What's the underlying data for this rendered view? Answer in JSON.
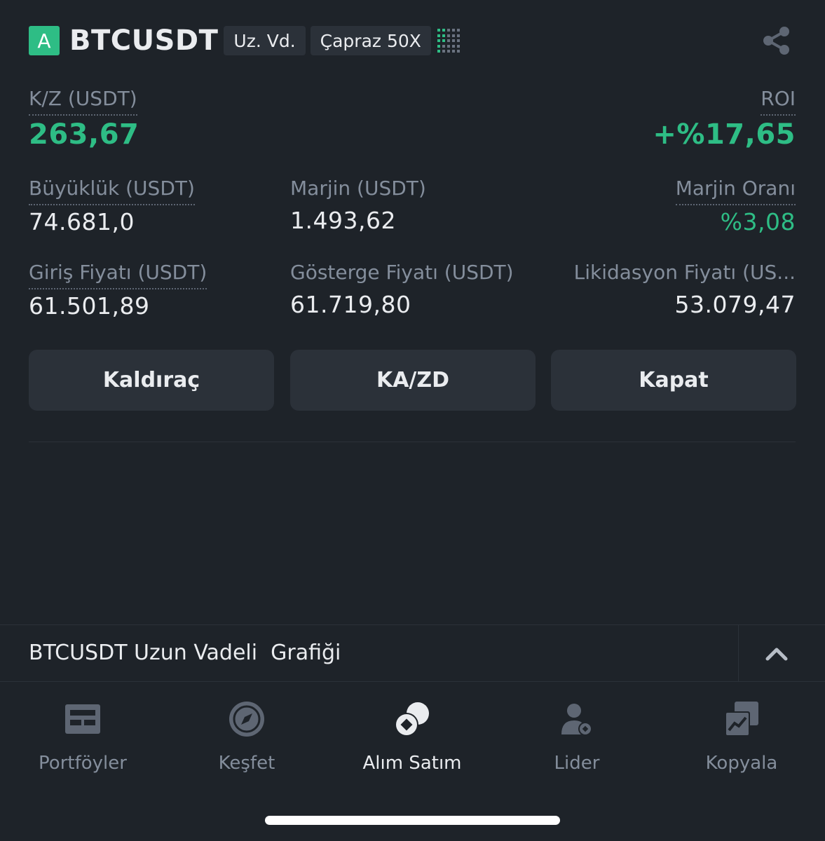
{
  "header": {
    "badge": "A",
    "symbol": "BTCUSDT",
    "tag_term": "Uz. Vd.",
    "tag_margin": "Çapraz 50X",
    "icon_share": "share-icon"
  },
  "position": {
    "pnl_label": "K/Z (USDT)",
    "pnl_value": "263,67",
    "roi_label": "ROI",
    "roi_value": "+%17,65",
    "size_label": "Büyüklük (USDT)",
    "size_value": "74.681,0",
    "margin_label": "Marjin (USDT)",
    "margin_value": "1.493,62",
    "margin_ratio_label": "Marjin Oranı",
    "margin_ratio_value": "%3,08",
    "entry_label": "Giriş Fiyatı (USDT)",
    "entry_value": "61.501,89",
    "mark_label": "Gösterge Fiyatı (USDT)",
    "mark_value": "61.719,80",
    "liq_label": "Likidasyon Fiyatı (US...",
    "liq_value": "53.079,47"
  },
  "actions": {
    "leverage": "Kaldıraç",
    "tpsl": "KA/ZD",
    "close": "Kapat"
  },
  "chart_toggle": {
    "title": "BTCUSDT Uzun Vadeli  Grafiği"
  },
  "nav": {
    "items": [
      {
        "label": "Portföyler",
        "icon": "portfolio-icon"
      },
      {
        "label": "Keşfet",
        "icon": "compass-icon"
      },
      {
        "label": "Alım Satım",
        "icon": "trade-icon",
        "active": true
      },
      {
        "label": "Lider",
        "icon": "leader-icon"
      },
      {
        "label": "Kopyala",
        "icon": "copy-trade-icon"
      }
    ]
  },
  "colors": {
    "background": "#1e2329",
    "green": "#2ebd85",
    "muted": "#848e9c",
    "button": "#2b3139"
  }
}
